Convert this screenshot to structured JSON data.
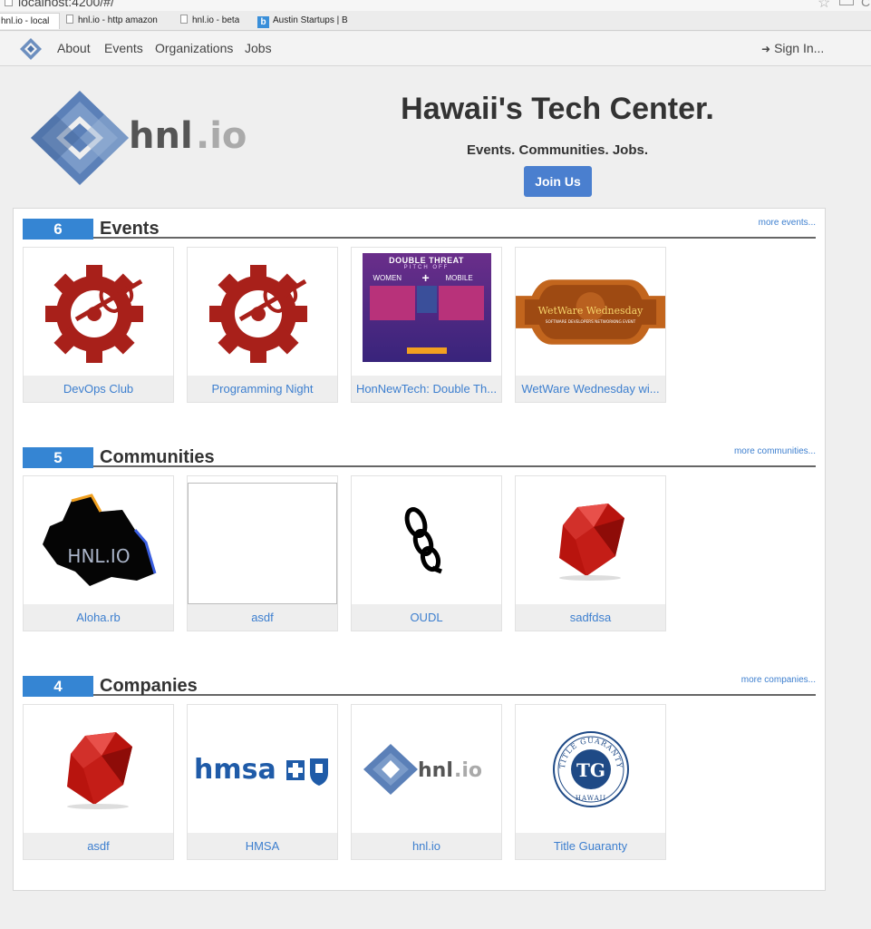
{
  "browser": {
    "url": "localhost:4200/#/",
    "bookmarks": [
      {
        "label": "hnl.io - local"
      },
      {
        "label": "hnl.io - http amazon"
      },
      {
        "label": "hnl.io - beta"
      },
      {
        "label": "Austin Startups | Bu"
      }
    ],
    "austin_icon": "b"
  },
  "nav": {
    "links": [
      "About",
      "Events",
      "Organizations",
      "Jobs"
    ],
    "sign_in": "Sign In...",
    "sign_in_icon": "➜"
  },
  "hero": {
    "logo_text_main": "hnl",
    "logo_text_dot": ".io",
    "title": "Hawaii's Tech Center.",
    "subtitle": "Events. Communities. Jobs.",
    "join_button": "Join Us",
    "brand_color": "#5b80b8"
  },
  "sections": {
    "events": {
      "count": "6",
      "title": "Events",
      "more": "more events...",
      "items": [
        {
          "label": "DevOps Club",
          "image": "devops-gear-logo"
        },
        {
          "label": "Programming Night",
          "image": "devops-gear-logo"
        },
        {
          "label": "HonNewTech: Double Th...",
          "image": "double-threat-poster"
        },
        {
          "label": "WetWare Wednesday wi...",
          "image": "wetware-banner"
        }
      ]
    },
    "communities": {
      "count": "5",
      "title": "Communities",
      "more": "more communities...",
      "items": [
        {
          "label": "Aloha.rb",
          "image": "oahu-hnl-logo"
        },
        {
          "label": "asdf",
          "image": "blank"
        },
        {
          "label": "OUDL",
          "image": "chain-icon"
        },
        {
          "label": "sadfdsa",
          "image": "ruby-gem"
        }
      ]
    },
    "companies": {
      "count": "4",
      "title": "Companies",
      "more": "more companies...",
      "items": [
        {
          "label": "asdf",
          "image": "ruby-gem"
        },
        {
          "label": "HMSA",
          "image": "hmsa-logo"
        },
        {
          "label": "hnl.io",
          "image": "hnl-logo"
        },
        {
          "label": "Title Guaranty",
          "image": "title-guaranty-seal"
        }
      ]
    }
  },
  "poster": {
    "line1": "DOUBLE THREAT",
    "line2": "PITCH OFF",
    "left": "WOMEN",
    "right": "MOBILE"
  },
  "wetware": {
    "title": "WetWare Wednesday",
    "subtitle": "SOFTWARE DEVELOPERS NETWORKING EVENT"
  },
  "hmsa_text": "hmsa",
  "tg": {
    "initials": "TG",
    "ring_top": "TITLE GUARANTY",
    "ring_bottom": "HAWAII"
  },
  "oahu_text": "HNL.IO"
}
